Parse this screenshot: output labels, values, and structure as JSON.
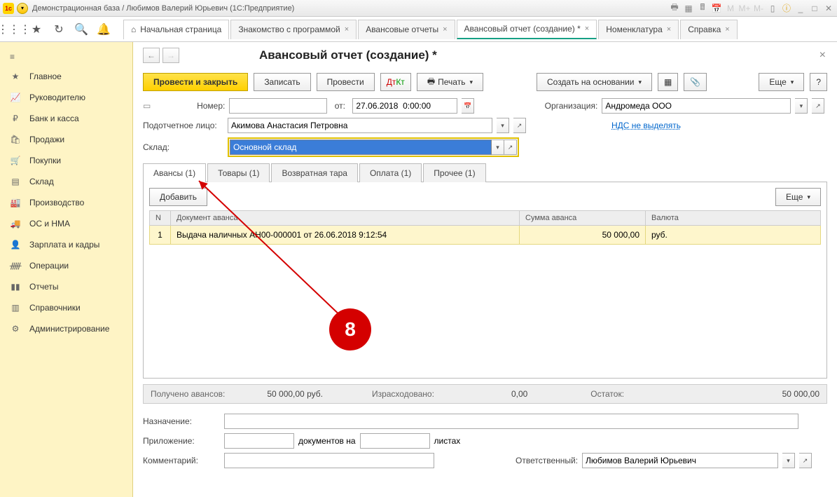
{
  "titlebar": {
    "title": "Демонстрационная база / Любимов Валерий Юрьевич  (1С:Предприятие)"
  },
  "tabs": {
    "home": "Начальная страница",
    "items": [
      {
        "label": "Знакомство с программой"
      },
      {
        "label": "Авансовые отчеты"
      },
      {
        "label": "Авансовый отчет (создание) *",
        "active": true
      },
      {
        "label": "Номенклатура"
      },
      {
        "label": "Справка"
      }
    ]
  },
  "sidebar": {
    "items": [
      {
        "icon": "≡",
        "label": "Главное"
      },
      {
        "icon": "📈",
        "label": "Руководителю"
      },
      {
        "icon": "₽",
        "label": "Банк и касса"
      },
      {
        "icon": "🛍",
        "label": "Продажи"
      },
      {
        "icon": "🛒",
        "label": "Покупки"
      },
      {
        "icon": "📦",
        "label": "Склад"
      },
      {
        "icon": "🏭",
        "label": "Производство"
      },
      {
        "icon": "🚚",
        "label": "ОС и НМА"
      },
      {
        "icon": "👤",
        "label": "Зарплата и кадры"
      },
      {
        "icon": "🔀",
        "label": "Операции"
      },
      {
        "icon": "📊",
        "label": "Отчеты"
      },
      {
        "icon": "📚",
        "label": "Справочники"
      },
      {
        "icon": "⚙",
        "label": "Администрирование"
      }
    ]
  },
  "page": {
    "title": "Авансовый отчет (создание) *",
    "buttons": {
      "post_close": "Провести и закрыть",
      "save": "Записать",
      "post": "Провести",
      "print": "Печать",
      "create_based": "Создать на основании",
      "more": "Еще"
    },
    "form": {
      "number_label": "Номер:",
      "number_value": "",
      "from_label": "от:",
      "date_value": "27.06.2018  0:00:00",
      "org_label": "Организация:",
      "org_value": "Андромеда ООО",
      "person_label": "Подотчетное лицо:",
      "person_value": "Акимова Анастасия Петровна",
      "vat_link": "НДС не выделять",
      "warehouse_label": "Склад:",
      "warehouse_value": "Основной склад"
    },
    "subtabs": [
      {
        "label": "Авансы (1)",
        "active": true
      },
      {
        "label": "Товары (1)"
      },
      {
        "label": "Возвратная тара"
      },
      {
        "label": "Оплата (1)"
      },
      {
        "label": "Прочее (1)"
      }
    ],
    "panel": {
      "add": "Добавить",
      "more": "Еще",
      "columns": {
        "n": "N",
        "doc": "Документ аванса",
        "sum": "Сумма аванса",
        "cur": "Валюта"
      },
      "rows": [
        {
          "n": "1",
          "doc": "Выдача наличных АН00-000001 от 26.06.2018 9:12:54",
          "sum": "50 000,00",
          "cur": "руб."
        }
      ]
    },
    "totals": {
      "received_label": "Получено авансов:",
      "received_value": "50 000,00  руб.",
      "spent_label": "Израсходовано:",
      "spent_value": "0,00",
      "remain_label": "Остаток:",
      "remain_value": "50 000,00"
    },
    "bottom": {
      "purpose_label": "Назначение:",
      "attach_label": "Приложение:",
      "docs_label": "документов на",
      "sheets_label": "листах",
      "comment_label": "Комментарий:",
      "responsible_label": "Ответственный:",
      "responsible_value": "Любимов Валерий Юрьевич"
    }
  },
  "marker": "8"
}
